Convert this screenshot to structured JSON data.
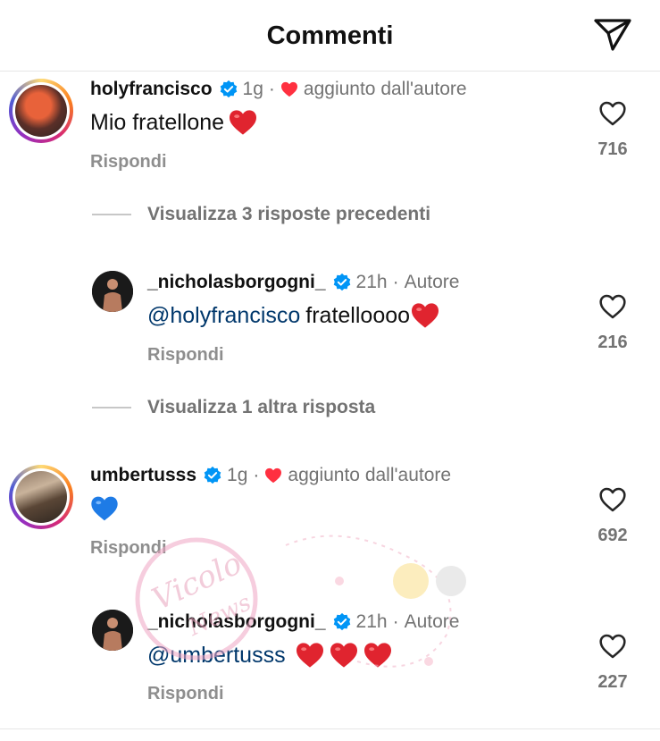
{
  "header": {
    "title": "Commenti",
    "send_icon": "send-icon"
  },
  "comments": [
    {
      "username": "holyfrancisco",
      "time": "1g",
      "badge": "aggiunto dall'autore",
      "text": "Mio fratellone",
      "reply_label": "Rispondi",
      "like_count": "716",
      "view_replies": "Visualizza 3 risposte precedenti",
      "reply": {
        "username": "_nicholasborgogni_",
        "time": "21h",
        "badge": "Autore",
        "mention": "@holyfrancisco",
        "text": "fratelloooo",
        "reply_label": "Rispondi",
        "like_count": "216"
      },
      "view_more": "Visualizza 1 altra risposta"
    },
    {
      "username": "umbertusss",
      "time": "1g",
      "badge": "aggiunto dall'autore",
      "reply_label": "Rispondi",
      "like_count": "692",
      "reply": {
        "username": "_nicholasborgogni_",
        "time": "21h",
        "badge": "Autore",
        "mention": "@umbertusss",
        "reply_label": "Rispondi",
        "like_count": "227"
      }
    }
  ],
  "colors": {
    "link": "#00376b",
    "verified": "#0095f6",
    "heart": "#ff3040",
    "muted": "#737373"
  },
  "watermark": {
    "text": "Vicolo delle News"
  }
}
